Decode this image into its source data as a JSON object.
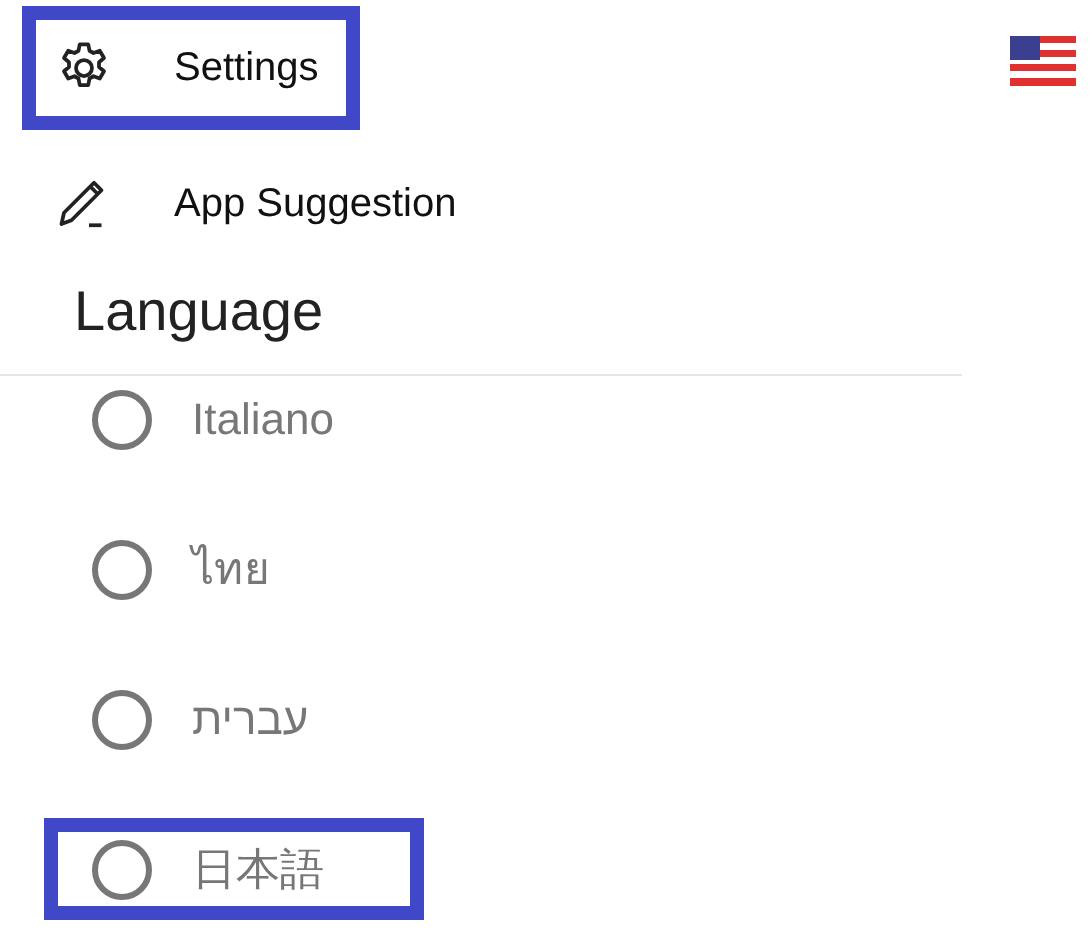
{
  "menu": [
    {
      "kind": "settings",
      "label": "Settings",
      "highlighted": true
    },
    {
      "kind": "suggestion",
      "label": "App Suggestion",
      "highlighted": false
    }
  ],
  "language": {
    "title": "Language",
    "options": [
      {
        "label": "Italiano",
        "selected": false,
        "highlighted": false
      },
      {
        "label": "ไทย",
        "selected": false,
        "highlighted": false
      },
      {
        "label": "עברית",
        "selected": false,
        "highlighted": false
      },
      {
        "label": "日本語",
        "selected": false,
        "highlighted": true
      }
    ]
  }
}
